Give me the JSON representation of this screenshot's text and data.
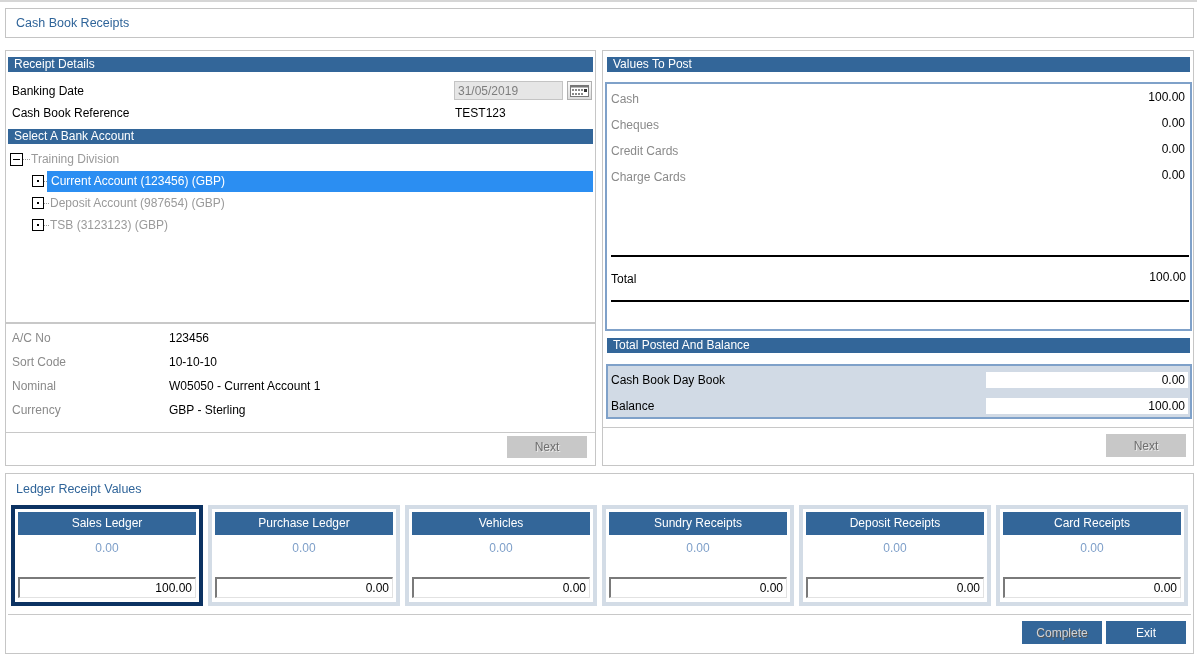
{
  "title": "Cash Book Receipts",
  "receipt_details": {
    "heading": "Receipt Details",
    "fields": [
      {
        "kind": "date",
        "label": "Banking Date",
        "value": "31/05/2019",
        "disabled": true
      },
      {
        "kind": "text",
        "label": "Cash Book Reference",
        "value": "TEST123"
      }
    ]
  },
  "bank_account": {
    "heading": "Select A Bank Account",
    "tree": [
      {
        "label": "Training Division",
        "expanded": true,
        "selected": false,
        "children": [
          {
            "label": "Current Account (123456) (GBP)",
            "expanded": false,
            "selected": true
          },
          {
            "label": "Deposit Account (987654) (GBP)",
            "expanded": false,
            "selected": false
          },
          {
            "label": "TSB (3123123) (GBP)",
            "expanded": false,
            "selected": false
          }
        ]
      }
    ],
    "details": [
      {
        "label": "A/C No",
        "value": "123456"
      },
      {
        "label": "Sort Code",
        "value": "10-10-10"
      },
      {
        "label": "Nominal",
        "value": "W05050 - Current Account 1"
      },
      {
        "label": "Currency",
        "value": "GBP - Sterling"
      }
    ],
    "next_button": {
      "label": "Next",
      "disabled": true
    }
  },
  "values_to_post": {
    "heading": "Values To Post",
    "rows": [
      {
        "label": "Cash",
        "value": "100.00"
      },
      {
        "label": "Cheques",
        "value": "0.00"
      },
      {
        "label": "Credit Cards",
        "value": "0.00"
      },
      {
        "label": "Charge Cards",
        "value": "0.00"
      }
    ],
    "total": {
      "label": "Total",
      "value": "100.00"
    }
  },
  "total_posted": {
    "heading": "Total Posted And Balance",
    "rows": [
      {
        "label": "Cash Book Day Book",
        "value": "0.00"
      },
      {
        "label": "Balance",
        "value": "100.00"
      }
    ],
    "next_button": {
      "label": "Next",
      "disabled": true
    }
  },
  "ledger": {
    "heading": "Ledger Receipt Values",
    "cards": [
      {
        "label": "Sales Ledger",
        "posted": "0.00",
        "value": "100.00",
        "selected": true
      },
      {
        "label": "Purchase Ledger",
        "posted": "0.00",
        "value": "0.00",
        "selected": false
      },
      {
        "label": "Vehicles",
        "posted": "0.00",
        "value": "0.00",
        "selected": false
      },
      {
        "label": "Sundry Receipts",
        "posted": "0.00",
        "value": "0.00",
        "selected": false
      },
      {
        "label": "Deposit Receipts",
        "posted": "0.00",
        "value": "0.00",
        "selected": false
      },
      {
        "label": "Card Receipts",
        "posted": "0.00",
        "value": "0.00",
        "selected": false
      }
    ]
  },
  "buttons": [
    {
      "label": "Complete",
      "disabled": true
    },
    {
      "label": "Exit",
      "disabled": false
    }
  ]
}
